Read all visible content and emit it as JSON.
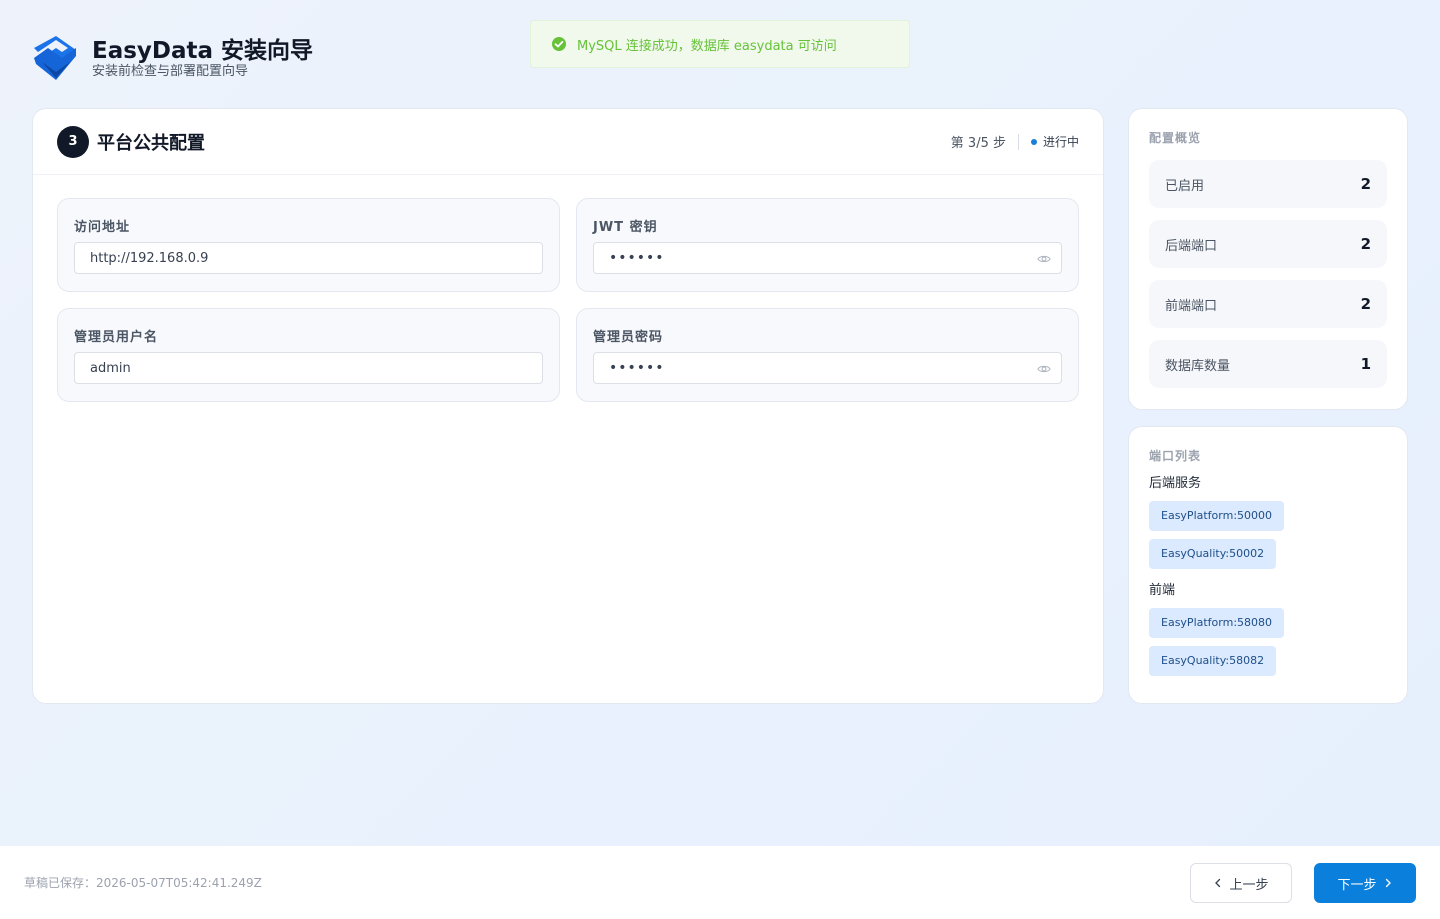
{
  "brand": {
    "title": "EasyData 安装向导",
    "subtitle": "安装前检查与部署配置向导"
  },
  "toast": {
    "message": "MySQL 连接成功，数据库 easydata 可访问",
    "icon": "check-circle-icon",
    "color": "#67c23a"
  },
  "step": {
    "number": "3",
    "title": "平台公共配置",
    "progress": "第 3/5 步",
    "status": "进行中"
  },
  "fields": [
    {
      "label": "访问地址",
      "value": "http://192.168.0.9",
      "type": "text"
    },
    {
      "label": "JWT 密钥",
      "value": "••••••",
      "type": "password"
    },
    {
      "label": "管理员用户名",
      "value": "admin",
      "type": "text"
    },
    {
      "label": "管理员密码",
      "value": "••••••",
      "type": "password"
    }
  ],
  "overview": {
    "title": "配置概览",
    "stats": [
      {
        "label": "已启用",
        "value": "2"
      },
      {
        "label": "后端端口",
        "value": "2"
      },
      {
        "label": "前端端口",
        "value": "2"
      },
      {
        "label": "数据库数量",
        "value": "1"
      }
    ]
  },
  "ports": {
    "title": "端口列表",
    "backend_label": "后端服务",
    "backend": [
      "EasyPlatform:50000",
      "EasyQuality:50002"
    ],
    "frontend_label": "前端",
    "frontend": [
      "EasyPlatform:58080",
      "EasyQuality:58082"
    ]
  },
  "footer": {
    "draft": "草稿已保存：2026-05-07T05:42:41.249Z",
    "prev_label": "上一步",
    "next_label": "下一步"
  },
  "colors": {
    "accent": "#0b7fdc",
    "tag_bg": "#dbeafe",
    "success": "#67c23a"
  }
}
